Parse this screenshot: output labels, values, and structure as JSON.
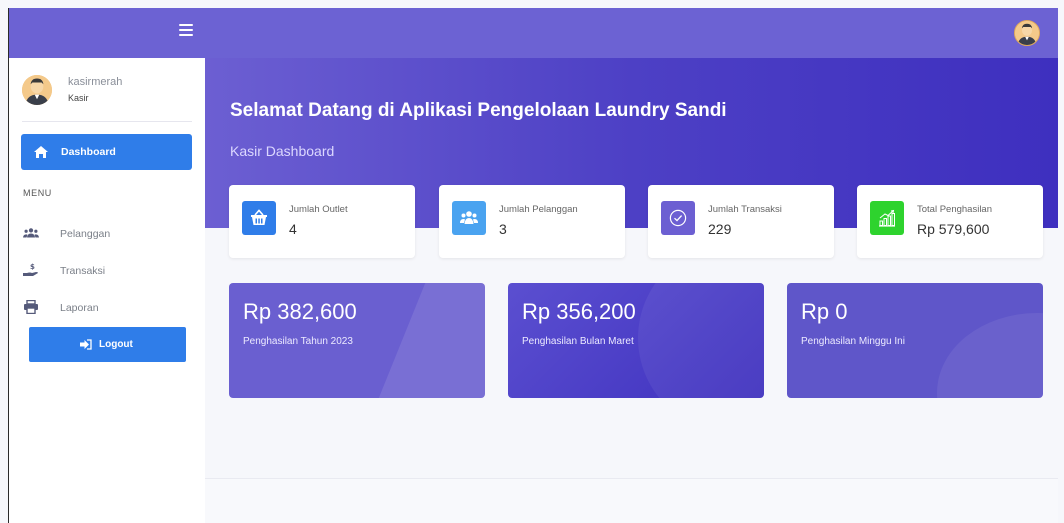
{
  "colors": {
    "topbar": "#6c62d3",
    "primary_button": "#2f7de9",
    "hero_start": "#6c5fd2",
    "hero_end": "#3e2fbf",
    "stat_outlet_icon_bg": "#2f7de9",
    "stat_pelanggan_icon_bg": "#4aa3f0",
    "stat_transaksi_icon_bg": "#6c5fd2",
    "stat_penghasilan_icon_bg": "#2ed32e"
  },
  "topbar": {
    "menu_icon": "hamburger-icon",
    "avatar_icon": "user-avatar-icon"
  },
  "sidebar": {
    "user": {
      "name": "kasirmerah",
      "role": "Kasir"
    },
    "active_item": {
      "label": "Dashboard",
      "icon": "home-icon"
    },
    "menu_heading": "MENU",
    "items": [
      {
        "label": "Pelanggan",
        "icon": "users-icon"
      },
      {
        "label": "Transaksi",
        "icon": "hand-money-icon"
      },
      {
        "label": "Laporan",
        "icon": "printer-icon"
      }
    ],
    "logout": {
      "label": "Logout",
      "icon": "sign-out-icon"
    }
  },
  "hero": {
    "title": "Selamat Datang di Aplikasi Pengelolaan Laundry Sandi",
    "subtitle": "Kasir Dashboard"
  },
  "stats": [
    {
      "label": "Jumlah Outlet",
      "value": "4",
      "icon": "store-basket-icon"
    },
    {
      "label": "Jumlah Pelanggan",
      "value": "3",
      "icon": "users-icon"
    },
    {
      "label": "Jumlah Transaksi",
      "value": "229",
      "icon": "check-circle-icon"
    },
    {
      "label": "Total Penghasilan",
      "value": "Rp 579,600",
      "icon": "bar-chart-icon"
    }
  ],
  "summaries": [
    {
      "amount": "Rp 382,600",
      "label": "Penghasilan Tahun 2023"
    },
    {
      "amount": "Rp 356,200",
      "label": "Penghasilan Bulan Maret"
    },
    {
      "amount": "Rp 0",
      "label": "Penghasilan Minggu Ini"
    }
  ]
}
